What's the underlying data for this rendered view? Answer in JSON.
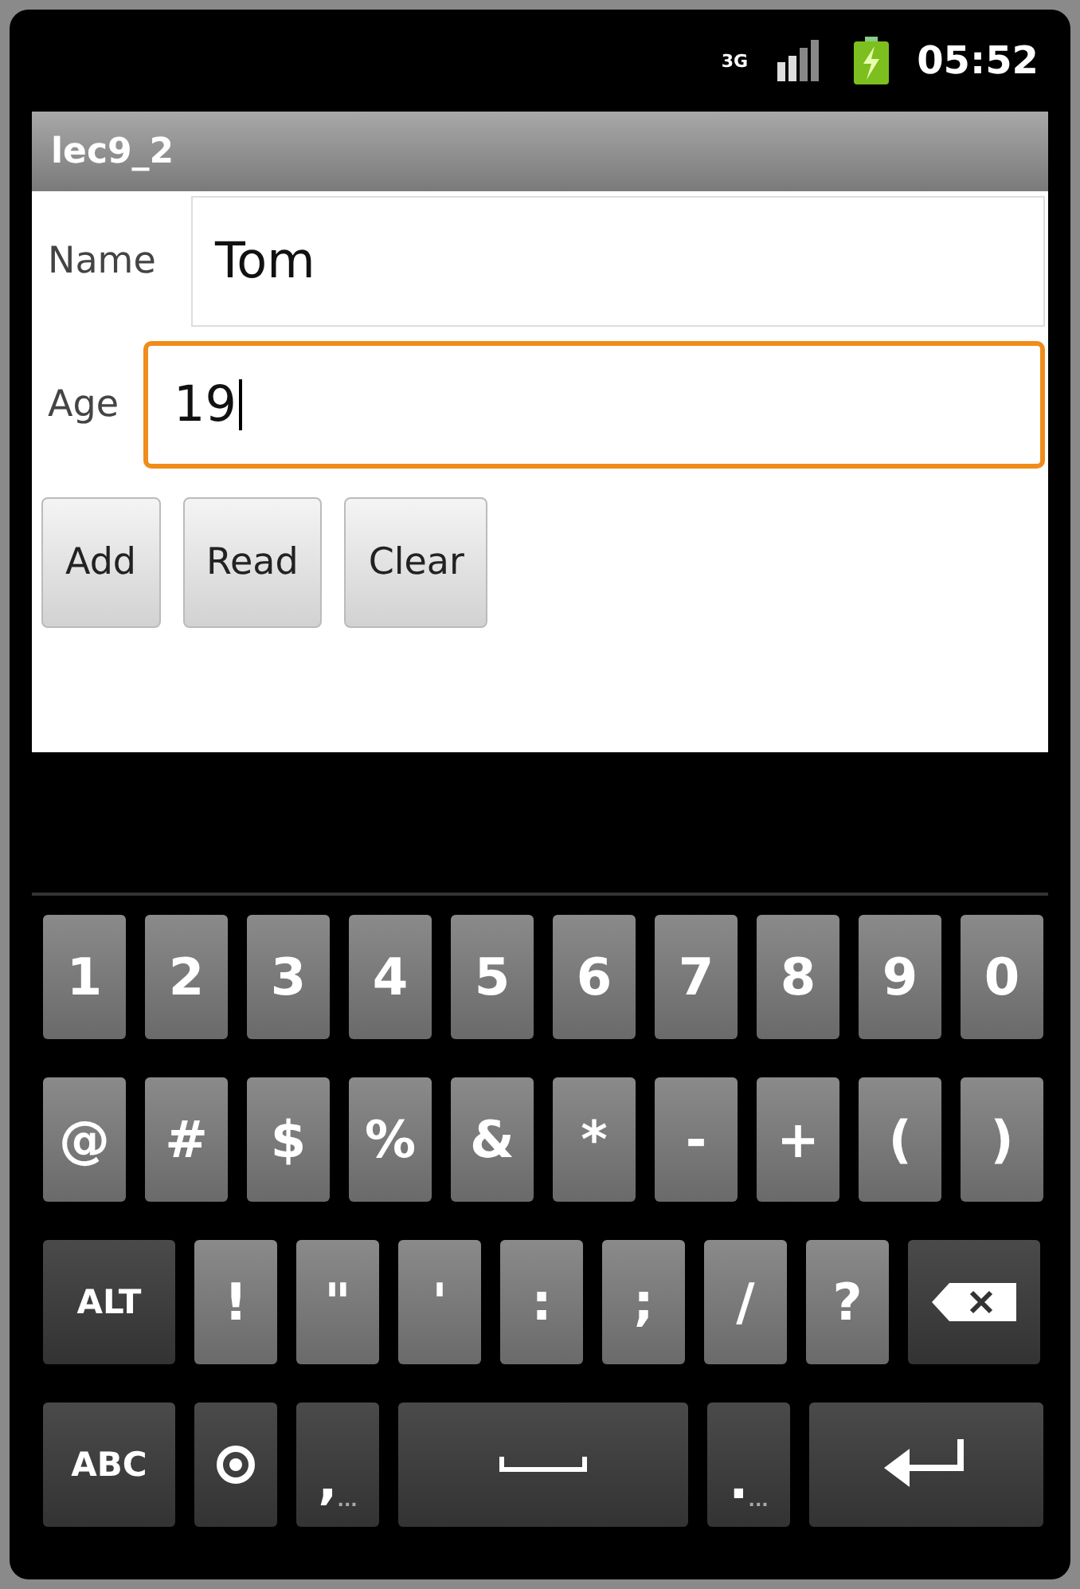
{
  "status_bar": {
    "network": "3G",
    "time": "05:52"
  },
  "window": {
    "title": "lec9_2"
  },
  "fields": [
    {
      "label": "Name",
      "value": "Tom",
      "focused": false
    },
    {
      "label": "Age",
      "value": "19",
      "focused": true
    }
  ],
  "buttons": [
    "Add",
    "Read",
    "Clear"
  ],
  "keyboard": {
    "rows": [
      [
        {
          "kind": "char",
          "label": "1"
        },
        {
          "kind": "char",
          "label": "2"
        },
        {
          "kind": "char",
          "label": "3"
        },
        {
          "kind": "char",
          "label": "4"
        },
        {
          "kind": "char",
          "label": "5"
        },
        {
          "kind": "char",
          "label": "6"
        },
        {
          "kind": "char",
          "label": "7"
        },
        {
          "kind": "char",
          "label": "8"
        },
        {
          "kind": "char",
          "label": "9"
        },
        {
          "kind": "char",
          "label": "0"
        }
      ],
      [
        {
          "kind": "char",
          "label": "@"
        },
        {
          "kind": "char",
          "label": "#"
        },
        {
          "kind": "char",
          "label": "$"
        },
        {
          "kind": "char",
          "label": "%"
        },
        {
          "kind": "char",
          "label": "&"
        },
        {
          "kind": "char",
          "label": "*"
        },
        {
          "kind": "char",
          "label": "-"
        },
        {
          "kind": "char",
          "label": "+"
        },
        {
          "kind": "char",
          "label": "("
        },
        {
          "kind": "char",
          "label": ")"
        }
      ],
      [
        {
          "kind": "mod",
          "label": "ALT"
        },
        {
          "kind": "char",
          "label": "!"
        },
        {
          "kind": "char",
          "label": "\""
        },
        {
          "kind": "char",
          "label": "'"
        },
        {
          "kind": "char",
          "label": ":"
        },
        {
          "kind": "char",
          "label": ";"
        },
        {
          "kind": "char",
          "label": "/"
        },
        {
          "kind": "char",
          "label": "?"
        },
        {
          "kind": "backspace"
        }
      ],
      [
        {
          "kind": "mod",
          "label": "ABC"
        },
        {
          "kind": "settings"
        },
        {
          "kind": "dark-char",
          "label": ",",
          "hint": "..."
        },
        {
          "kind": "space"
        },
        {
          "kind": "dark-char",
          "label": ".",
          "hint": "..."
        },
        {
          "kind": "enter"
        }
      ]
    ]
  }
}
